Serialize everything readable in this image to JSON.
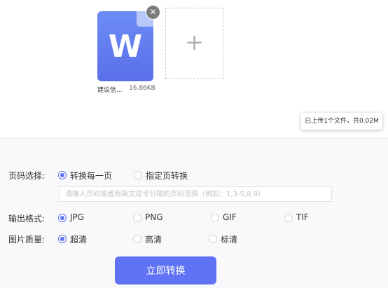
{
  "file": {
    "icon": "word-document-icon",
    "letter": "W",
    "name": "建议信...",
    "size": "16.86KB",
    "remove_icon": "close-icon",
    "remove_glyph": "✕"
  },
  "add_file": {
    "icon": "plus-icon",
    "glyph": "+"
  },
  "upload_summary": "已上传1个文件，共0.02M",
  "page_select": {
    "label": "页码选择:",
    "options": [
      "转换每一页",
      "指定页转换"
    ],
    "selected": 0,
    "range_placeholder": "请输入页码或者用英文逗号分隔的页码范围（例如：1,3-5,8,9）"
  },
  "output_format": {
    "label": "输出格式:",
    "options": [
      "JPG",
      "PNG",
      "GIF",
      "TIF"
    ],
    "selected": 0
  },
  "image_quality": {
    "label": "图片质量:",
    "options": [
      "超清",
      "高清",
      "标清"
    ],
    "selected": 0
  },
  "convert_button": "立即转换",
  "colors": {
    "accent": "#5b6ff2",
    "button": "#6173f5",
    "doc_icon": "#5a6fe8"
  }
}
